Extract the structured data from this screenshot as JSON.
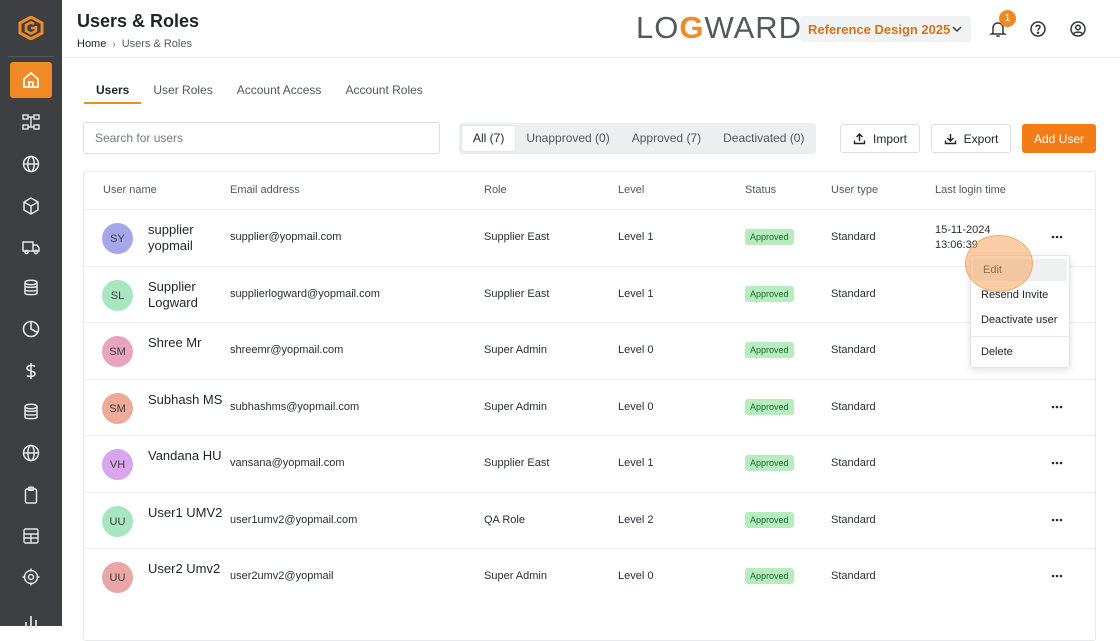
{
  "header": {
    "title": "Users & Roles",
    "breadcrumb": [
      "Home",
      "Users & Roles"
    ],
    "brand_text_left": "LO",
    "brand_text_g": "G",
    "brand_text_right": "WARD",
    "project": "Reference Design 2025",
    "notification_count": "1"
  },
  "sidebar": {
    "items": [
      {
        "icon": "home-icon",
        "active": true
      },
      {
        "icon": "network-icon"
      },
      {
        "icon": "globe-icon"
      },
      {
        "icon": "box-icon"
      },
      {
        "icon": "truck-icon"
      },
      {
        "icon": "database-icon"
      },
      {
        "icon": "pie-chart-icon"
      },
      {
        "icon": "dollar-icon"
      },
      {
        "icon": "database-icon"
      },
      {
        "icon": "globe-icon"
      },
      {
        "icon": "clipboard-icon"
      },
      {
        "icon": "grid-icon"
      },
      {
        "icon": "target-icon"
      },
      {
        "icon": "bar-chart-icon"
      }
    ]
  },
  "tabs": [
    "Users",
    "User Roles",
    "Account Access",
    "Account Roles"
  ],
  "search": {
    "placeholder": "Search for users"
  },
  "filters": [
    "All (7)",
    "Unapproved (0)",
    "Approved (7)",
    "Deactivated (0)"
  ],
  "actions": {
    "import": "Import",
    "export": "Export",
    "add_user": "Add User"
  },
  "table": {
    "columns": [
      "User name",
      "Email address",
      "Role",
      "Level",
      "Status",
      "User type",
      "Last login time"
    ],
    "rows": [
      {
        "initials": "SY",
        "avatar_color": "#a5a6ec",
        "name": "supplier yopmail",
        "email": "supplier@yopmail.com",
        "role": "Supplier East",
        "level": "Level 1",
        "status": "Approved",
        "type": "Standard",
        "last_login": "15-11-2024 13:06:39"
      },
      {
        "initials": "SL",
        "avatar_color": "#a8e6c0",
        "name": "Supplier Logward",
        "email": "supplierlogward@yopmail.com",
        "role": "Supplier East",
        "level": "Level 1",
        "status": "Approved",
        "type": "Standard",
        "last_login": ""
      },
      {
        "initials": "SM",
        "avatar_color": "#eaa3bd",
        "name": "Shree Mr",
        "email": "shreemr@yopmail.com",
        "role": "Super Admin",
        "level": "Level 0",
        "status": "Approved",
        "type": "Standard",
        "last_login": ""
      },
      {
        "initials": "SM",
        "avatar_color": "#eeaa99",
        "name": "Subhash MS",
        "email": "subhashms@yopmail.com",
        "role": "Super Admin",
        "level": "Level 0",
        "status": "Approved",
        "type": "Standard",
        "last_login": ""
      },
      {
        "initials": "VH",
        "avatar_color": "#d9a5ec",
        "name": "Vandana HU",
        "email": "vansana@yopmail.com",
        "role": "Supplier East",
        "level": "Level 1",
        "status": "Approved",
        "type": "Standard",
        "last_login": ""
      },
      {
        "initials": "UU",
        "avatar_color": "#a8e6c0",
        "name": "User1 UMV2",
        "email": "user1umv2@yopmail.com",
        "role": "QA Role",
        "level": "Level 2",
        "status": "Approved",
        "type": "Standard",
        "last_login": ""
      },
      {
        "initials": "UU",
        "avatar_color": "#e9a6a6",
        "name": "User2 Umv2",
        "email": "user2umv2@yopmail",
        "role": "Super Admin",
        "level": "Level 0",
        "status": "Approved",
        "type": "Standard",
        "last_login": ""
      }
    ]
  },
  "row_menu": {
    "items": [
      "Edit",
      "Resend Invite",
      "Deactivate user",
      "Delete"
    ]
  },
  "colors": {
    "accent": "#f08a24",
    "sidebar": "#3d3f42",
    "status_bg": "#b7ecbf"
  }
}
